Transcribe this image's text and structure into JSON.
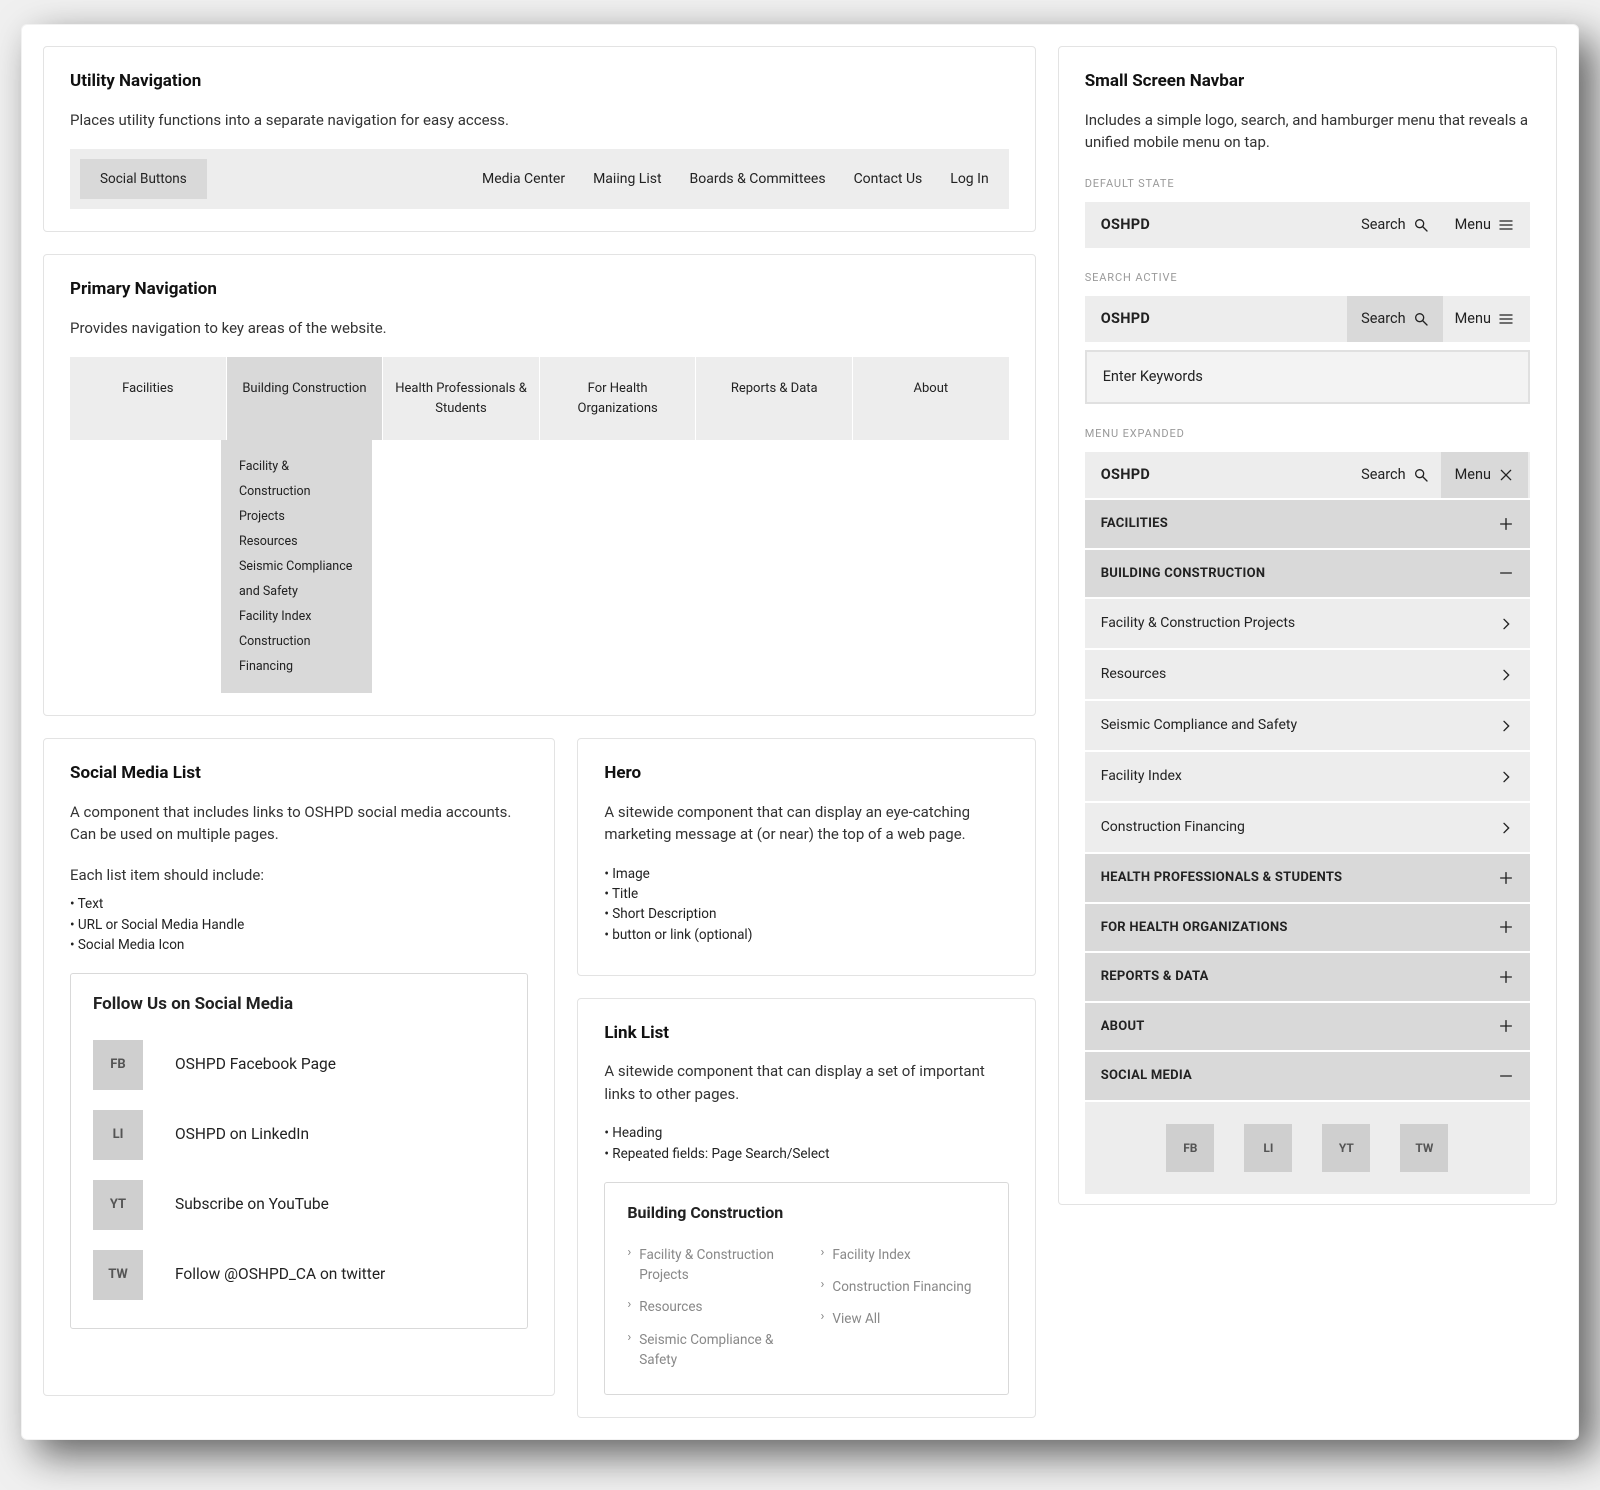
{
  "util": {
    "title": "Utility Navigation",
    "desc": "Places utility functions into a separate navigation for easy access.",
    "social_ph": "Social Buttons",
    "links": [
      "Media Center",
      "Maiing List",
      "Boards & Committees",
      "Contact Us",
      "Log In"
    ]
  },
  "primary": {
    "title": "Primary Navigation",
    "desc": "Provides navigation to key areas of the website.",
    "items": [
      "Facilities",
      "Building Construction",
      "Health Professionals & Students",
      "For Health Organizations",
      "Reports & Data",
      "About"
    ],
    "dropdown": [
      "Facility & Construction Projects",
      "Resources",
      "Seismic Compliance and Safety",
      "Facility Index",
      "Construction Financing"
    ]
  },
  "social": {
    "title": "Social Media List",
    "desc1": "A component that includes links to OSHPD social media accounts. Can be used on multiple pages.",
    "desc2": "Each list item should include:",
    "bullets": [
      "Text",
      "URL or Social Media Handle",
      "Social Media Icon"
    ],
    "box_title": "Follow Us on Social Media",
    "items": [
      {
        "icon": "FB",
        "label": "OSHPD Facebook Page"
      },
      {
        "icon": "LI",
        "label": "OSHPD on LinkedIn"
      },
      {
        "icon": "YT",
        "label": "Subscribe on YouTube"
      },
      {
        "icon": "TW",
        "label": "Follow @OSHPD_CA on twitter"
      }
    ]
  },
  "hero": {
    "title": "Hero",
    "desc": "A sitewide component that can display an eye-catching marketing message at (or near) the top of a web page.",
    "bullets": [
      "Image",
      "Title",
      "Short Description",
      "button or link (optional)"
    ]
  },
  "linklist": {
    "title": "Link List",
    "desc": "A sitewide component that can display a set of important links to other pages.",
    "bullets": [
      "Heading",
      "Repeated fields: Page Search/Select"
    ],
    "box_title": "Building Construction",
    "col1": [
      "Facility & Construction Projects",
      "Resources",
      "Seismic Compliance & Safety"
    ],
    "col2": [
      "Facility Index",
      "Construction Financing",
      "View All"
    ]
  },
  "ssn": {
    "title": "Small Screen Navbar",
    "desc": "Includes a simple logo, search, and hamburger menu that reveals a unified mobile menu on tap.",
    "state_default": "DEFAULT STATE",
    "state_search": "SEARCH ACTIVE",
    "state_menu": "MENU EXPANDED",
    "logo": "OSHPD",
    "search": "Search",
    "menu": "Menu",
    "search_ph": "Enter Keywords",
    "acc_tops": [
      "FACILITIES",
      "BUILDING CONSTRUCTION",
      "HEALTH PROFESSIONALS & STUDENTS",
      "FOR HEALTH ORGANIZATIONS",
      "REPORTS & DATA",
      "ABOUT",
      "SOCIAL MEDIA"
    ],
    "acc_subs": [
      "Facility & Construction Projects",
      "Resources",
      "Seismic Compliance and Safety",
      "Facility Index",
      "Construction Financing"
    ],
    "social_icons": [
      "FB",
      "LI",
      "YT",
      "TW"
    ]
  }
}
